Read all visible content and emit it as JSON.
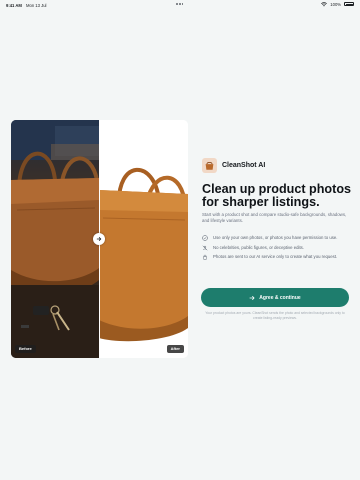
{
  "status_bar": {
    "time": "9:41 AM",
    "date": "Mon 13 Jul",
    "battery": "100%"
  },
  "compare": {
    "before_label": "Before",
    "after_label": "After"
  },
  "brand": {
    "name": "CleanShot AI"
  },
  "headline": "Clean up product photos for sharper listings.",
  "subtitle": "Start with a product shot and compare studio-safe backgrounds, shadows, and lifestyle variants.",
  "bullets": [
    {
      "icon": "check-circle-icon",
      "text": "Use only your own photos, or photos you have permission to use."
    },
    {
      "icon": "no-people-icon",
      "text": "No celebrities, public figures, or deceptive edits."
    },
    {
      "icon": "lock-icon",
      "text": "Photos are sent to our AI service only to create what you request."
    }
  ],
  "agree_button": {
    "label": "Agree & continue",
    "icon": "arrow-right-icon"
  },
  "footnote": "Your product photos are yours. CleanShot sends the photo and selected backgrounds only to create listing-ready previews.",
  "colors": {
    "accent": "#1e7d6d",
    "background": "#f3f6f6",
    "logo_bg": "#f1d8c6"
  }
}
